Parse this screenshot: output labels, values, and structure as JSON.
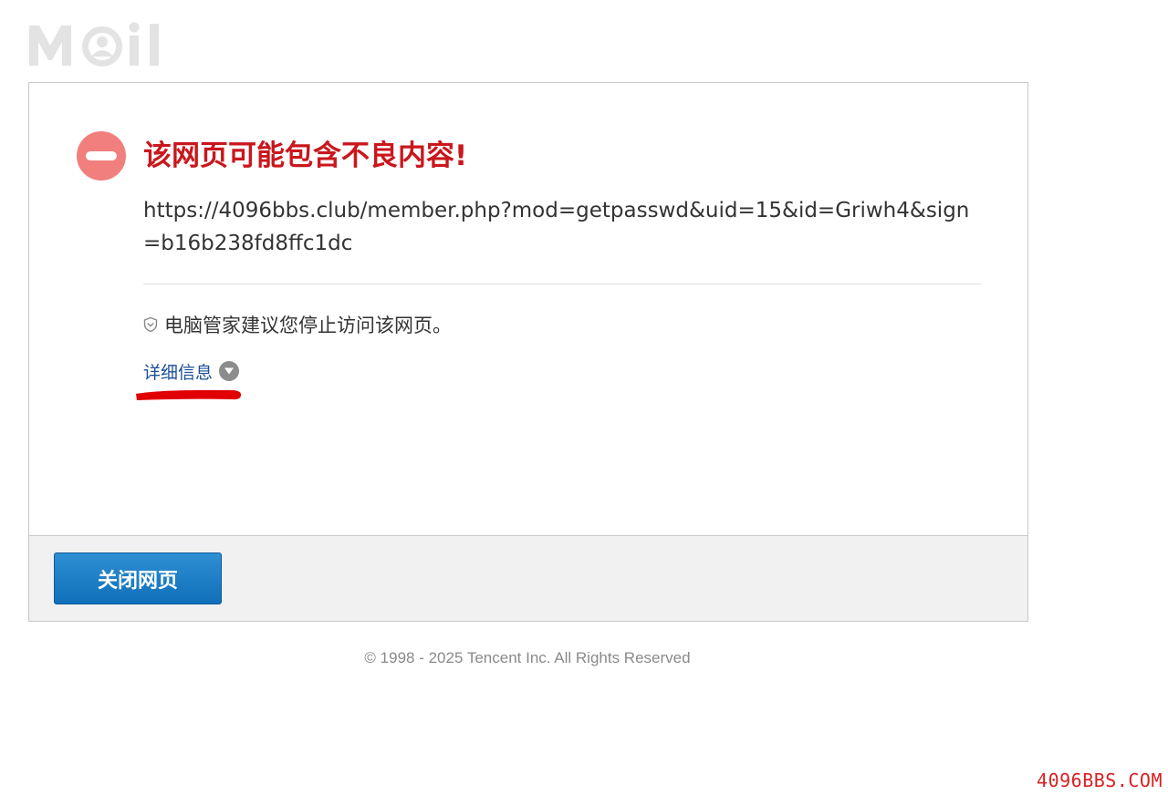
{
  "brand": {
    "logo_text": "MOil",
    "logo_color": "#e3e3e3"
  },
  "warning": {
    "title": "该网页可能包含不良内容!",
    "url": "https://4096bbs.club/member.php?mod=getpasswd&uid=15&id=Griwh4&sign=b16b238fd8ffc1dc",
    "advice": "电脑管家建议您停止访问该网页。",
    "details_link": "详细信息",
    "icon_color": "#f07f7d",
    "title_color": "#c9171d"
  },
  "footer": {
    "close_button": "关闭网页",
    "button_color": "#1a7cc4"
  },
  "copyright": "© 1998 - 2025 Tencent Inc. All Rights Reserved",
  "watermark": "4096BBS.COM",
  "annotation_color": "#e00000"
}
